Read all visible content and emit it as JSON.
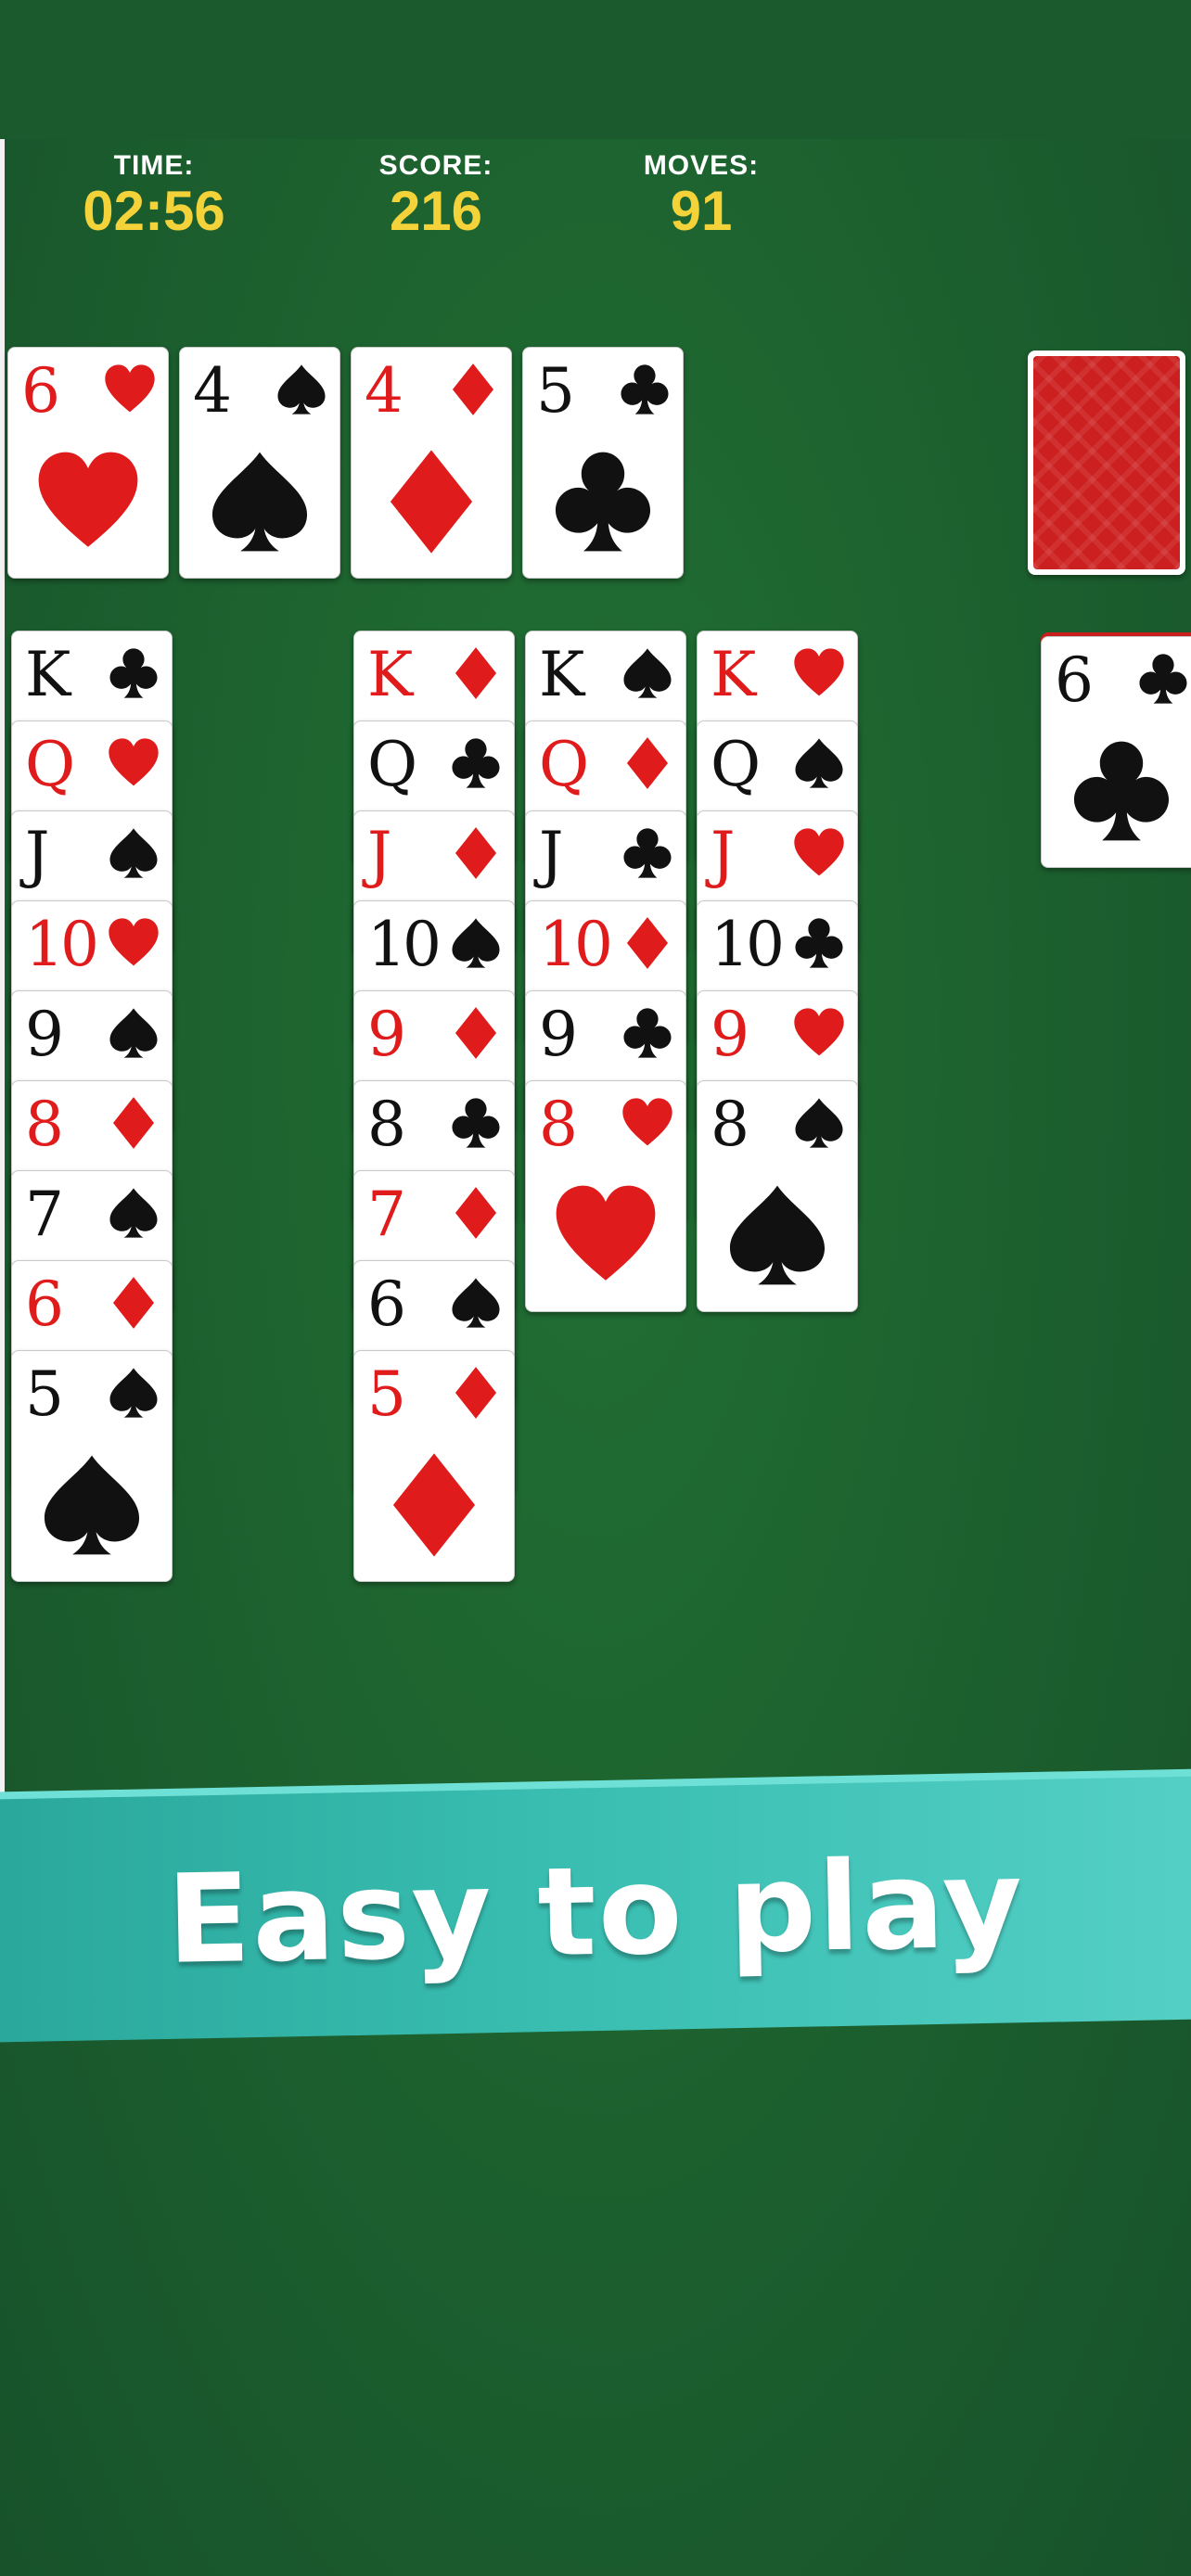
{
  "hud": {
    "time_label": "TIME:",
    "time_value": "02:56",
    "score_label": "SCORE:",
    "score_value": "216",
    "moves_label": "MOVES:",
    "moves_value": "91"
  },
  "banner": {
    "text": "Easy to play"
  },
  "colors": {
    "felt": "#1d5d2f",
    "hud_value": "#f3d23a",
    "card_red": "#e01b1b",
    "banner": "#38bdb0"
  },
  "foundations": [
    {
      "rank": "6",
      "suit": "heart"
    },
    {
      "rank": "4",
      "suit": "spade"
    },
    {
      "rank": "4",
      "suit": "diamond"
    },
    {
      "rank": "5",
      "suit": "club"
    }
  ],
  "waste": [
    {
      "rank": "6",
      "suit": "club"
    }
  ],
  "tableau": [
    [
      {
        "rank": "K",
        "suit": "club"
      },
      {
        "rank": "Q",
        "suit": "heart"
      },
      {
        "rank": "J",
        "suit": "spade"
      },
      {
        "rank": "10",
        "suit": "heart"
      },
      {
        "rank": "9",
        "suit": "spade"
      },
      {
        "rank": "8",
        "suit": "diamond"
      },
      {
        "rank": "7",
        "suit": "spade"
      },
      {
        "rank": "6",
        "suit": "diamond"
      },
      {
        "rank": "5",
        "suit": "spade"
      }
    ],
    [],
    [
      {
        "rank": "K",
        "suit": "diamond"
      },
      {
        "rank": "Q",
        "suit": "club"
      },
      {
        "rank": "J",
        "suit": "diamond"
      },
      {
        "rank": "10",
        "suit": "spade"
      },
      {
        "rank": "9",
        "suit": "diamond"
      },
      {
        "rank": "8",
        "suit": "club"
      },
      {
        "rank": "7",
        "suit": "diamond"
      },
      {
        "rank": "6",
        "suit": "spade"
      },
      {
        "rank": "5",
        "suit": "diamond"
      }
    ],
    [
      {
        "rank": "K",
        "suit": "spade"
      },
      {
        "rank": "Q",
        "suit": "diamond"
      },
      {
        "rank": "J",
        "suit": "club"
      },
      {
        "rank": "10",
        "suit": "diamond"
      },
      {
        "rank": "9",
        "suit": "club"
      },
      {
        "rank": "8",
        "suit": "heart"
      }
    ],
    [
      {
        "rank": "K",
        "suit": "heart"
      },
      {
        "rank": "Q",
        "suit": "spade"
      },
      {
        "rank": "J",
        "suit": "heart"
      },
      {
        "rank": "10",
        "suit": "club"
      },
      {
        "rank": "9",
        "suit": "heart"
      },
      {
        "rank": "8",
        "suit": "spade"
      }
    ]
  ]
}
